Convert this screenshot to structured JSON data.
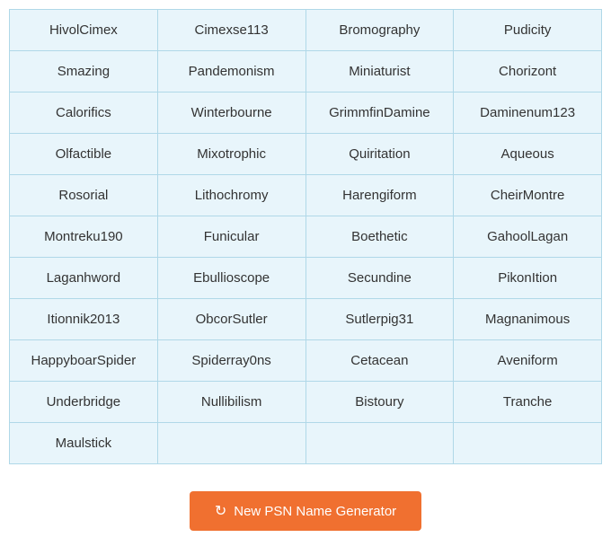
{
  "grid": {
    "items": [
      "HivolCimex",
      "Cimexse113",
      "Bromography",
      "Pudicity",
      "Smazing",
      "Pandemonism",
      "Miniaturist",
      "Chorizont",
      "Calorifics",
      "Winterbourne",
      "GrimmfinDamine",
      "Daminenum123",
      "Olfactible",
      "Mixotrophic",
      "Quiritation",
      "Aqueous",
      "Rosorial",
      "Lithochromy",
      "Harengiform",
      "CheirMontre",
      "Montreku190",
      "Funicular",
      "Boethetic",
      "GahoolLagan",
      "Laganhword",
      "Ebullioscope",
      "Secundine",
      "PikonItion",
      "Itionnik2013",
      "ObcorSutler",
      "Sutlerpig31",
      "Magnanimous",
      "HappyboarSpider",
      "Spiderray0ns",
      "Cetacean",
      "Aveniform",
      "Underbridge",
      "Nullibilism",
      "Bistoury",
      "Tranche",
      "Maulstick",
      "",
      "",
      ""
    ]
  },
  "button": {
    "label": "New PSN Name Generator",
    "icon": "refresh-icon"
  }
}
